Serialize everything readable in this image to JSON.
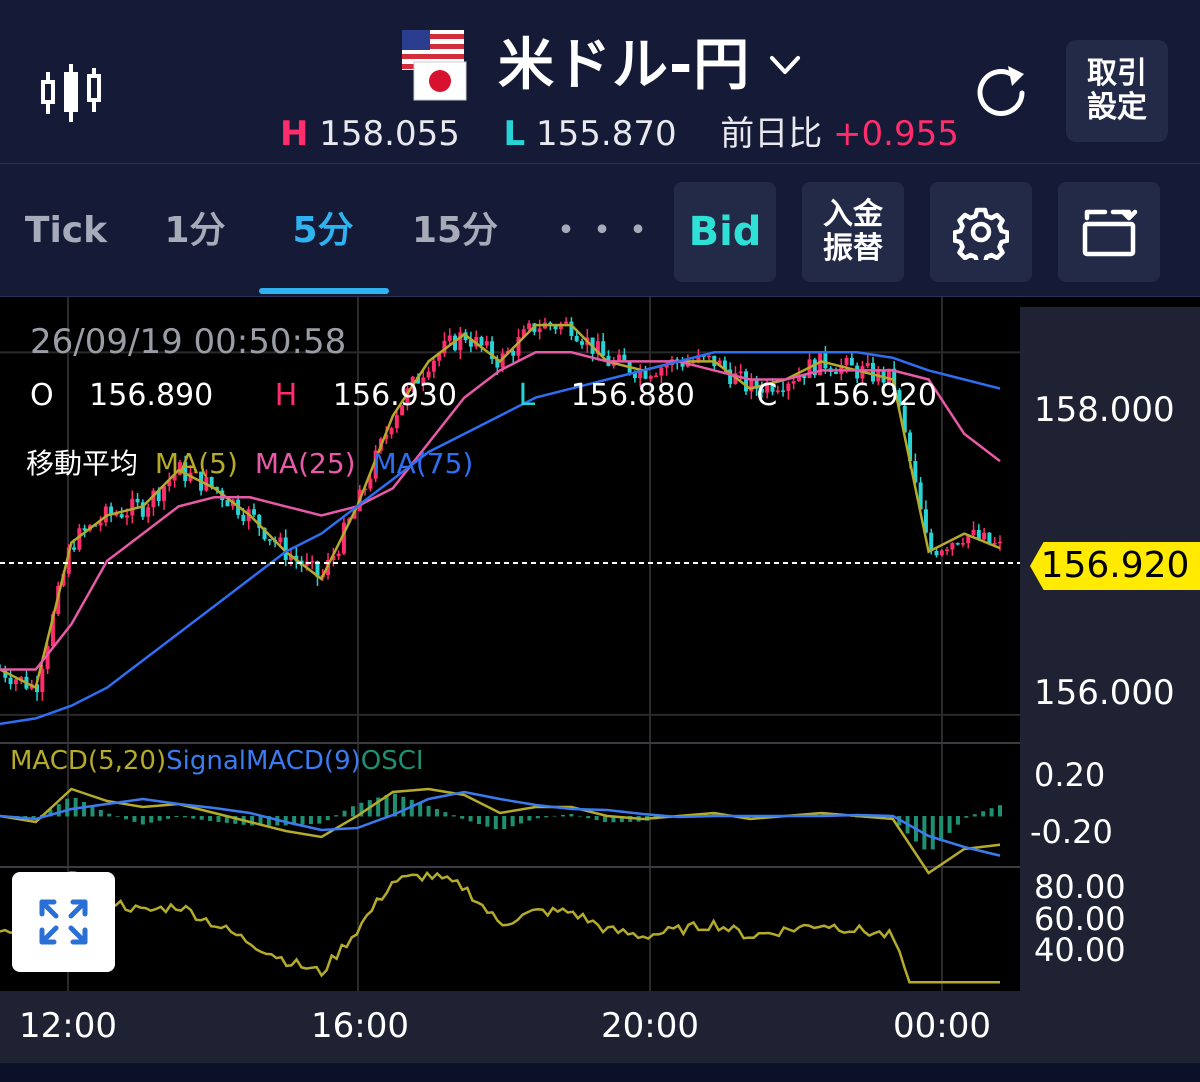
{
  "header": {
    "pair_title": "米ドル-円",
    "high_label": "H",
    "high_value": "158.055",
    "low_label": "L",
    "low_value": "155.870",
    "change_label": "前日比",
    "change_value": "+0.955",
    "trade_settings_label": "取引\n設定",
    "icons": [
      "candlestick-icon",
      "us-flag-icon",
      "japan-flag-icon",
      "chevron-down-icon",
      "refresh-icon"
    ]
  },
  "tabs": {
    "items": [
      "Tick",
      "1分",
      "5分",
      "15分",
      "・・・"
    ],
    "active": "5分",
    "bid_label": "Bid",
    "deposit_label": "入金\n振替",
    "icons": [
      "gear-icon",
      "rotate-screen-icon"
    ]
  },
  "chart": {
    "datetime": "26/09/19 00:50:58",
    "ohlc": {
      "o_label": "O",
      "o_value": "156.890",
      "h_label": "H",
      "h_value": "156.930",
      "l_label": "L",
      "l_value": "156.880",
      "c_label": "C",
      "c_value": "156.920"
    },
    "ma_legend": {
      "title": "移動平均",
      "ma5": "MA(5)",
      "ma25": "MA(25)",
      "ma75": "MA(75)"
    },
    "macd_legend": {
      "macd": "MACD(5,20)",
      "signal": "SignalMACD(9)",
      "osci": "OSCI"
    },
    "price_axis": [
      "158.000",
      "156.000"
    ],
    "current_price": "156.920",
    "macd_axis": [
      "0.20",
      "-0.20"
    ],
    "rsi_axis": [
      "80.00",
      "60.00",
      "40.00"
    ],
    "time_axis": [
      "12:00",
      "16:00",
      "20:00",
      "00:00"
    ],
    "colors": {
      "up": "#ff2d6b",
      "down": "#27d3d6",
      "ma5": "#b5ab2a",
      "ma25": "#e85aa8",
      "ma75": "#2e6ef0",
      "macd": "#b5ab2a",
      "signal": "#3a7cf0",
      "osci": "#1f8f72",
      "current_price_tag": "#ffea00",
      "active_tab": "#2fb2f0"
    }
  },
  "chart_data": {
    "type": "line",
    "x": [
      "11:00",
      "11:30",
      "12:00",
      "12:30",
      "13:00",
      "13:30",
      "14:00",
      "14:30",
      "15:00",
      "15:30",
      "16:00",
      "16:30",
      "17:00",
      "17:30",
      "18:00",
      "18:30",
      "19:00",
      "19:30",
      "20:00",
      "20:30",
      "21:00",
      "21:30",
      "22:00",
      "22:30",
      "23:00",
      "23:30",
      "00:00",
      "00:30",
      "00:50"
    ],
    "series": [
      {
        "name": "MA(5)",
        "values": [
          156.25,
          156.15,
          156.95,
          157.1,
          157.15,
          157.35,
          157.25,
          157.1,
          156.9,
          156.75,
          157.15,
          157.65,
          157.95,
          158.1,
          157.95,
          158.15,
          158.15,
          157.95,
          157.9,
          157.95,
          157.95,
          157.8,
          157.85,
          157.95,
          157.9,
          157.85,
          156.9,
          157.0,
          156.92
        ]
      },
      {
        "name": "MA(25)",
        "values": [
          156.25,
          156.25,
          156.5,
          156.85,
          157.0,
          157.15,
          157.2,
          157.2,
          157.15,
          157.1,
          157.15,
          157.25,
          157.5,
          157.75,
          157.9,
          158.0,
          158.0,
          157.95,
          157.95,
          157.95,
          157.9,
          157.85,
          157.85,
          157.9,
          157.9,
          157.9,
          157.85,
          157.55,
          157.4
        ]
      },
      {
        "name": "MA(75)",
        "values": [
          155.95,
          155.98,
          156.05,
          156.15,
          156.3,
          156.45,
          156.6,
          156.75,
          156.9,
          157.0,
          157.15,
          157.3,
          157.45,
          157.55,
          157.65,
          157.75,
          157.8,
          157.85,
          157.9,
          157.95,
          158.0,
          158.0,
          158.0,
          158.0,
          158.0,
          157.97,
          157.9,
          157.85,
          157.8
        ]
      }
    ],
    "ylim": [
      155.85,
      158.25
    ],
    "price_axis_ticks": [
      158.0,
      156.0
    ],
    "current_price": 156.92,
    "indicators": {
      "macd": {
        "series": [
          "MACD(5,20)",
          "SignalMACD(9)",
          "OSCI"
        ],
        "axis_ticks": [
          0.2,
          -0.2
        ]
      },
      "oscillator": {
        "axis_ticks": [
          80.0,
          60.0,
          40.0
        ]
      }
    }
  }
}
